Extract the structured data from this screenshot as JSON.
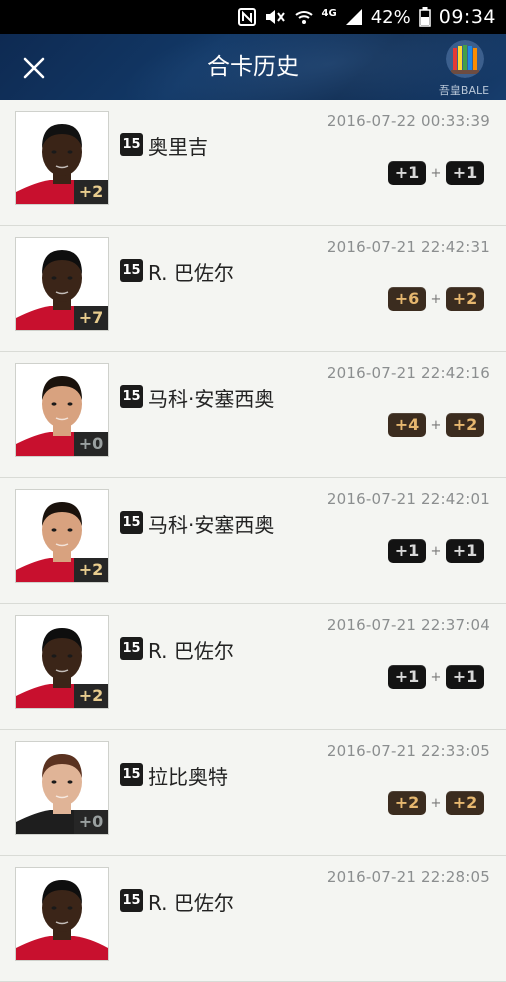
{
  "statusbar": {
    "network": "4G",
    "battery": "42%",
    "time": "09:34"
  },
  "header": {
    "title": "合卡历史",
    "user_name": "吾皇BALE"
  },
  "records": [
    {
      "name": "奥里吉",
      "season": "15",
      "time": "2016-07-22 00:33:39",
      "level": "+2",
      "a": "+1",
      "b": "+1",
      "a_style": "black",
      "b_style": "black",
      "skin": "#3a2417",
      "hair": "#111",
      "shirt": "#c8102e"
    },
    {
      "name": "R. 巴佐尔",
      "season": "15",
      "time": "2016-07-21 22:42:31",
      "level": "+7",
      "a": "+6",
      "b": "+2",
      "a_style": "bronze",
      "b_style": "bronze",
      "skin": "#3b2518",
      "hair": "#0e0e0e",
      "shirt": "#c8102e"
    },
    {
      "name": "马科·安塞西奥",
      "season": "15",
      "time": "2016-07-21 22:42:16",
      "level": "+0",
      "a": "+4",
      "b": "+2",
      "a_style": "bronze",
      "b_style": "bronze",
      "skin": "#d8a27f",
      "hair": "#1a120c",
      "shirt": "#c8102e"
    },
    {
      "name": "马科·安塞西奥",
      "season": "15",
      "time": "2016-07-21 22:42:01",
      "level": "+2",
      "a": "+1",
      "b": "+1",
      "a_style": "black",
      "b_style": "black",
      "skin": "#d8a27f",
      "hair": "#1a120c",
      "shirt": "#c8102e"
    },
    {
      "name": "R. 巴佐尔",
      "season": "15",
      "time": "2016-07-21 22:37:04",
      "level": "+2",
      "a": "+1",
      "b": "+1",
      "a_style": "black",
      "b_style": "black",
      "skin": "#3b2518",
      "hair": "#0e0e0e",
      "shirt": "#c8102e"
    },
    {
      "name": "拉比奥特",
      "season": "15",
      "time": "2016-07-21 22:33:05",
      "level": "+0",
      "a": "+2",
      "b": "+2",
      "a_style": "bronze",
      "b_style": "bronze",
      "skin": "#e0b497",
      "hair": "#5a3220",
      "shirt": "#1e1e1e"
    },
    {
      "name": "R. 巴佐尔",
      "season": "15",
      "time": "2016-07-21 22:28:05",
      "level": "",
      "a": "",
      "b": "",
      "a_style": "black",
      "b_style": "black",
      "skin": "#3b2518",
      "hair": "#0e0e0e",
      "shirt": "#c8102e"
    }
  ]
}
